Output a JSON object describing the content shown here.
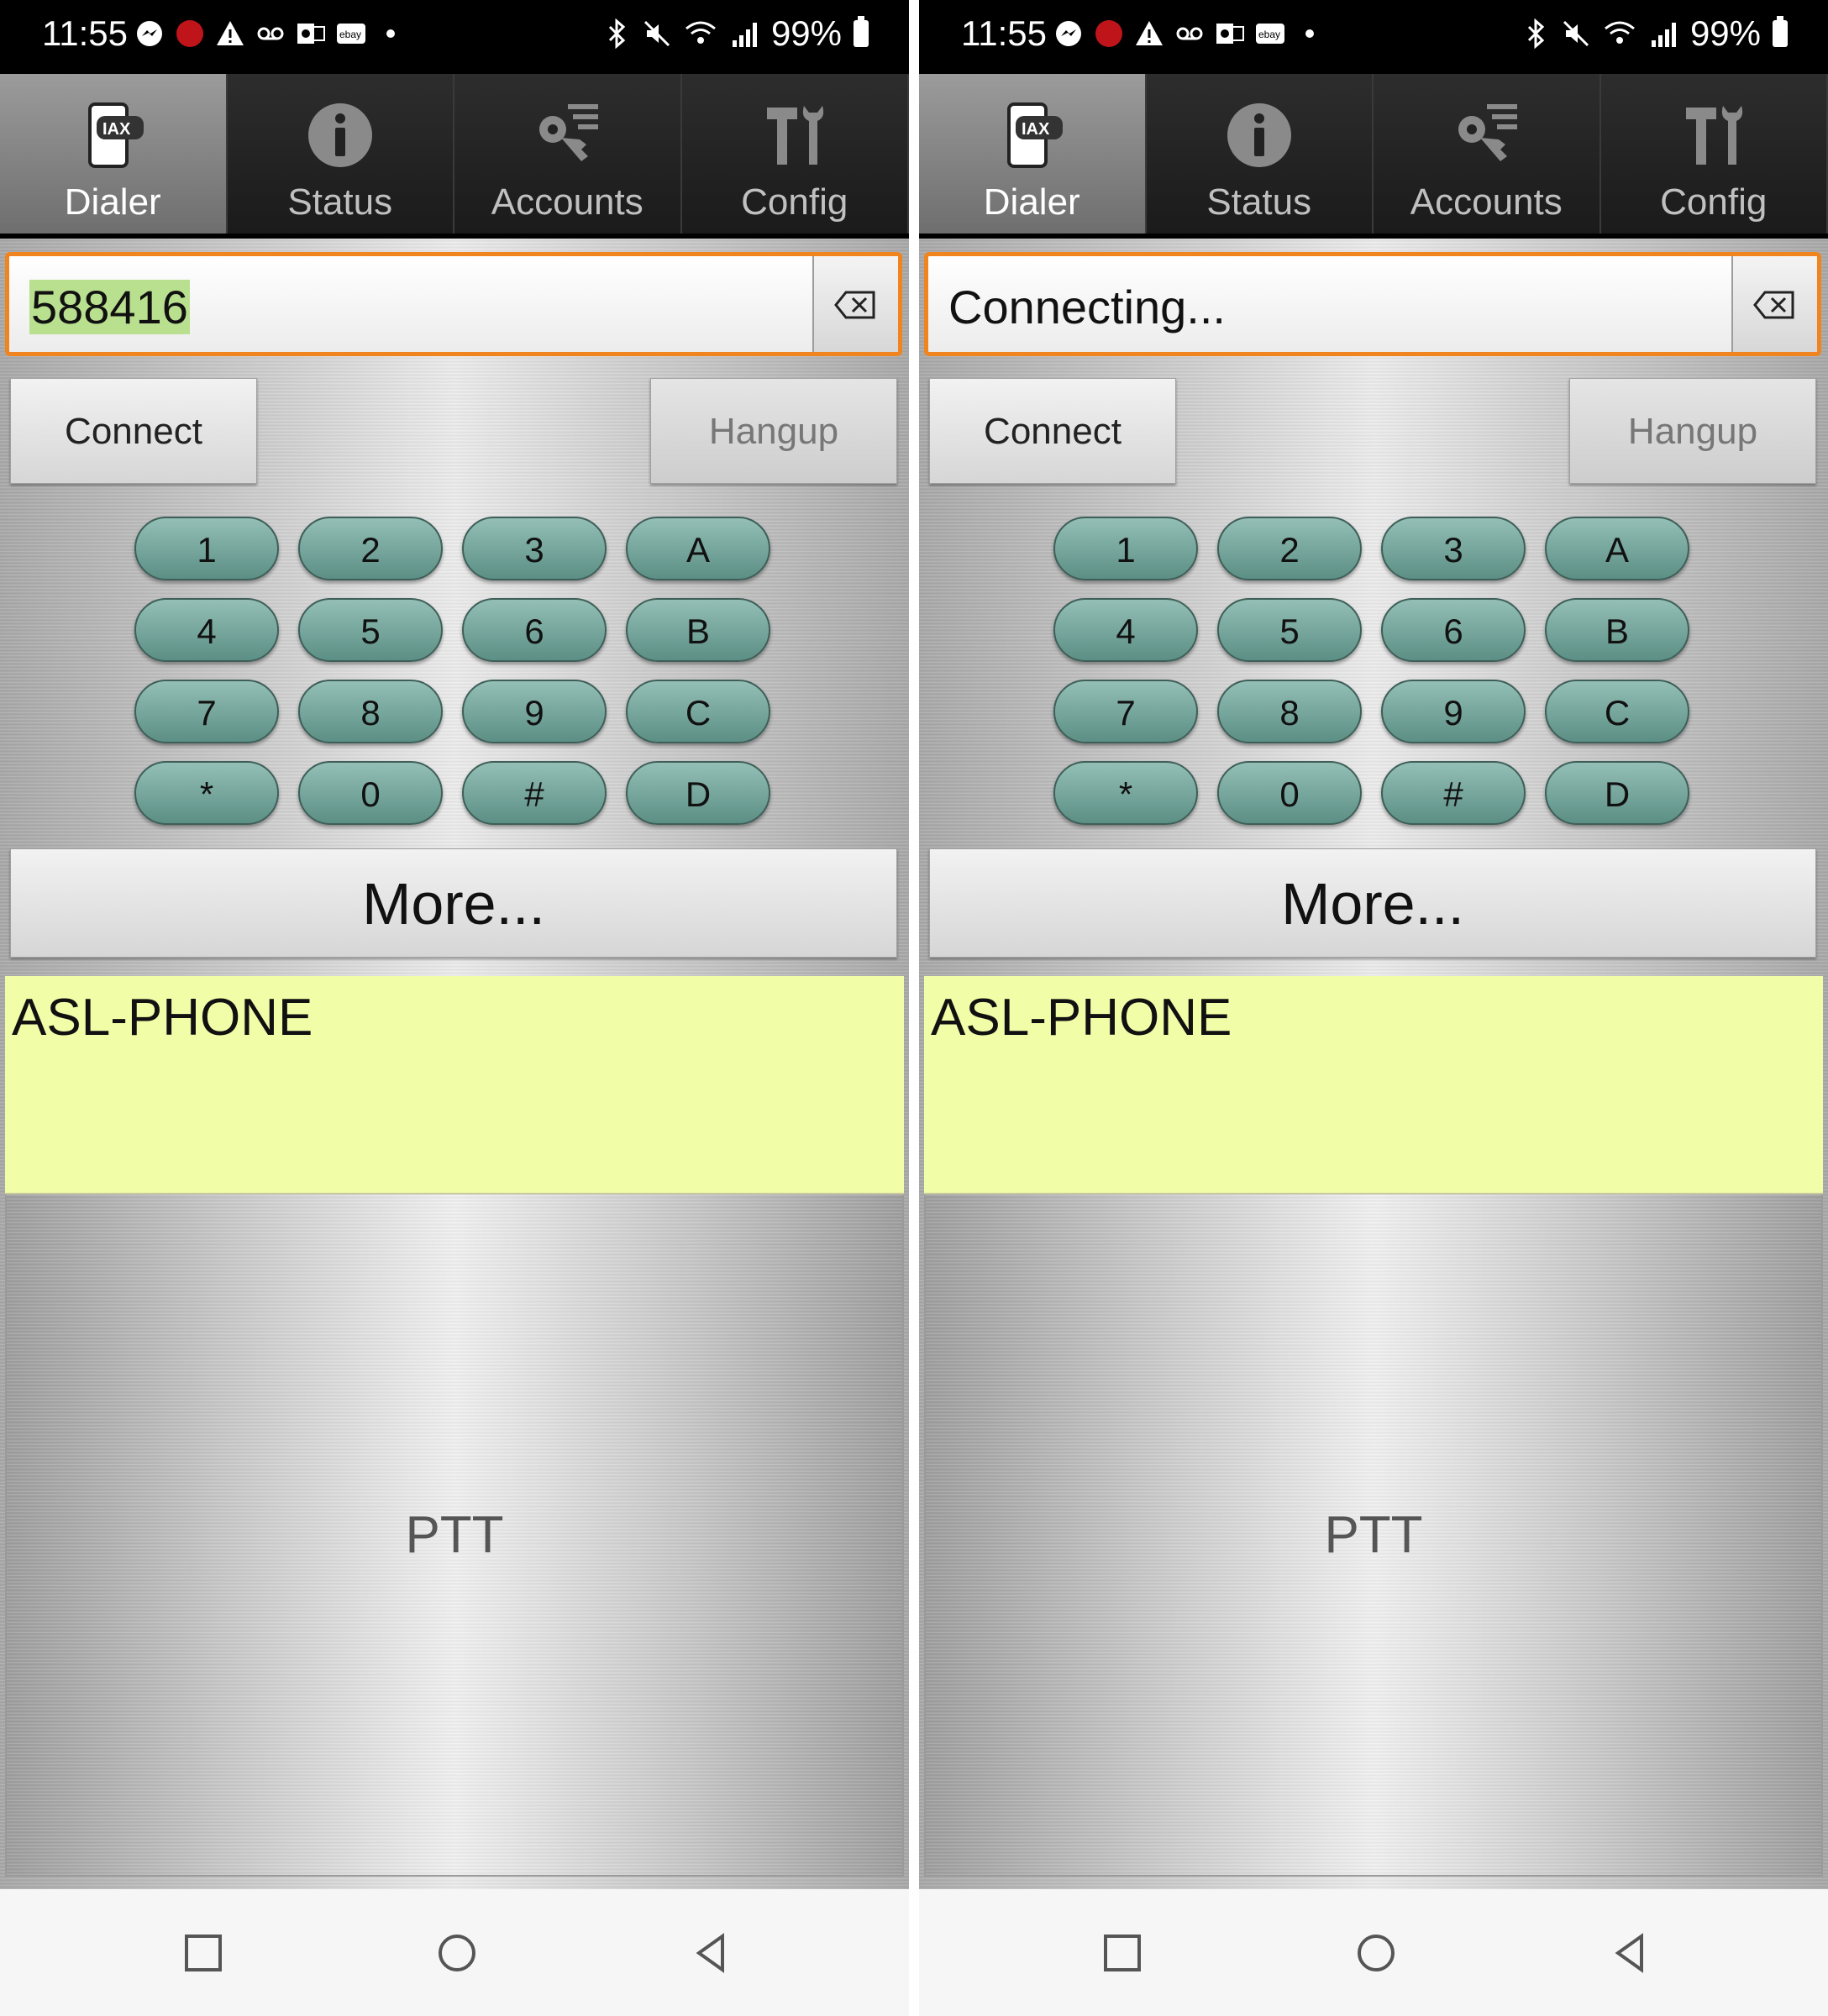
{
  "status_bar": {
    "time": "11:55",
    "battery": "99%"
  },
  "tabs": [
    "Dialer",
    "Status",
    "Accounts",
    "Config"
  ],
  "icons": {
    "dialer": "iax-phone-icon",
    "status": "info-icon",
    "accounts": "key-list-icon",
    "config": "tools-icon",
    "backspace": "backspace-icon",
    "nav_recent": "square-icon",
    "nav_home": "circle-icon",
    "nav_back": "triangle-back-icon"
  },
  "dialer_left": {
    "entry_text": "588416"
  },
  "dialer_right": {
    "entry_text": "Connecting..."
  },
  "buttons": {
    "connect": "Connect",
    "hangup": "Hangup",
    "more": "More..."
  },
  "keypad": [
    "1",
    "2",
    "3",
    "A",
    "4",
    "5",
    "6",
    "B",
    "7",
    "8",
    "9",
    "C",
    "*",
    "0",
    "#",
    "D"
  ],
  "info_text": "ASL-PHONE",
  "ptt_label": "PTT",
  "colors": {
    "accent_orange": "#f0841e",
    "key_teal": "#6f9f95",
    "info_yellow": "#f2fda8",
    "selection_green": "#b9e08f"
  }
}
